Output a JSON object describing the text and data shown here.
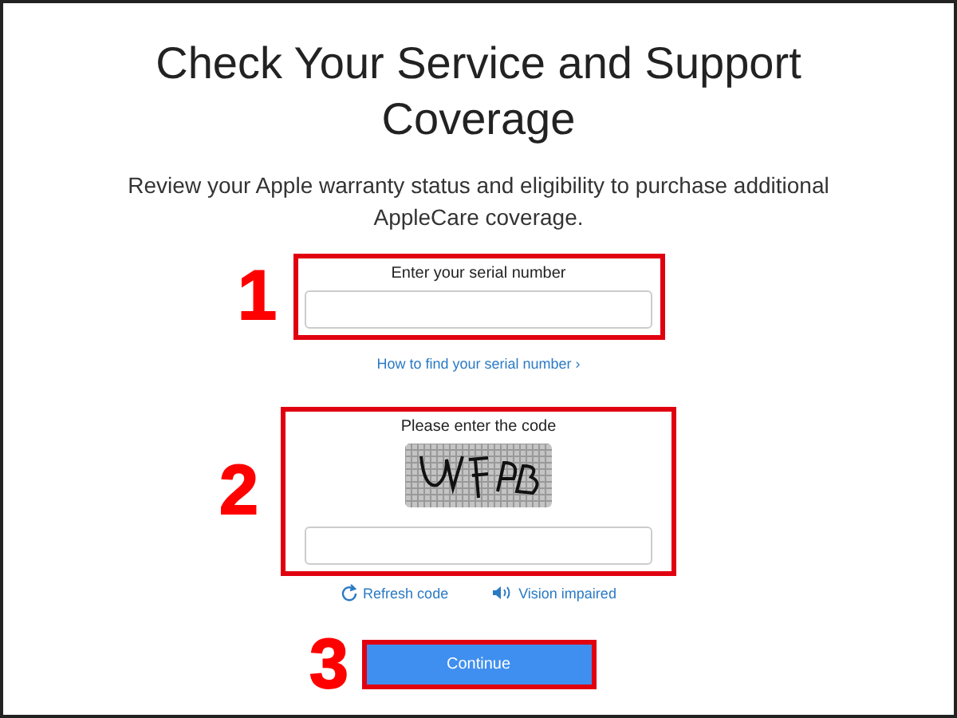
{
  "page": {
    "title": "Check Your Service and Support Coverage",
    "description": "Review your Apple warranty status and eligibility to purchase additional AppleCare coverage."
  },
  "serial_section": {
    "annotation": "1",
    "label": "Enter your serial number"
  },
  "help_link": "How to find your serial number ›",
  "captcha_section": {
    "annotation": "2",
    "label": "Please enter the code"
  },
  "captcha_links": [
    {
      "kind": "refresh",
      "label": "Refresh code"
    },
    {
      "kind": "audio",
      "label": "Vision impaired"
    }
  ],
  "continue_section": {
    "annotation": "3",
    "button": "Continue"
  }
}
